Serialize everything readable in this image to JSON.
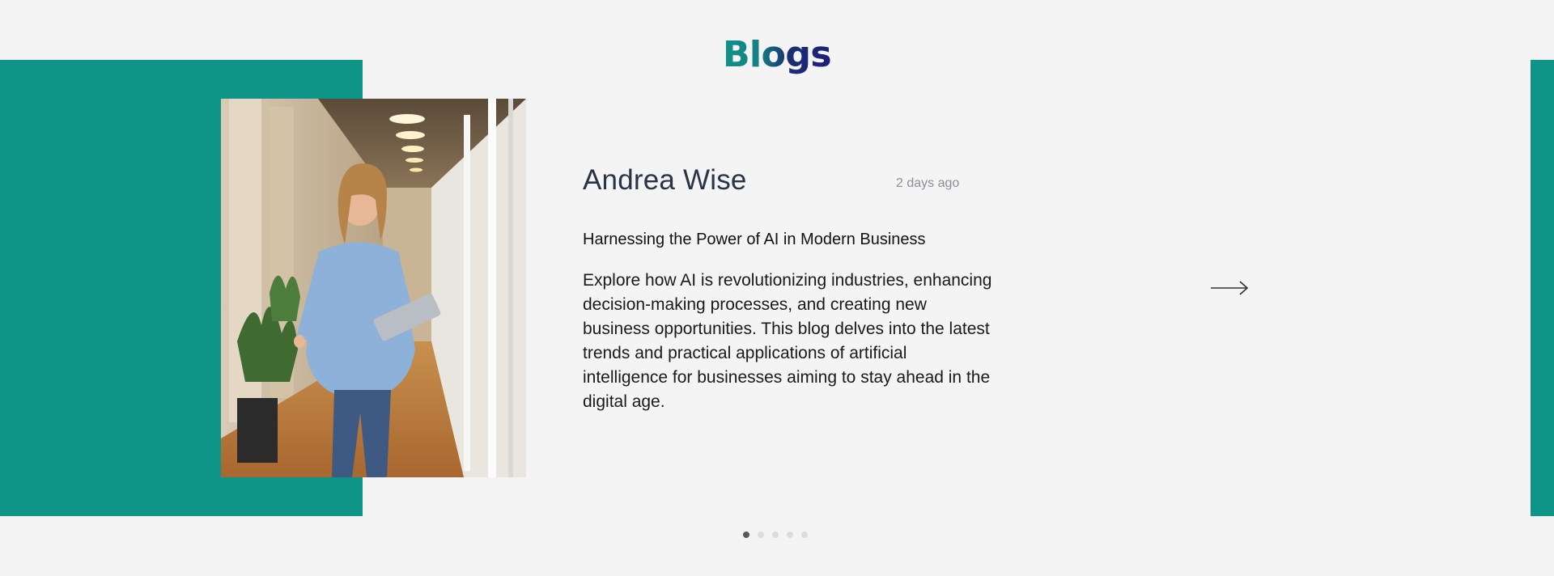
{
  "section": {
    "title": "Blogs"
  },
  "post": {
    "author": "Andrea Wise",
    "time_ago": "2 days ago",
    "title": "Harnessing the Power of AI in Modern Business",
    "excerpt": "Explore how AI is revolutionizing industries, enhancing decision-making processes, and creating new business opportunities. This blog delves into the latest trends and practical applications of artificial intelligence for businesses aiming to stay ahead in the digital age."
  },
  "navigation": {
    "next_icon": "arrow-right-icon",
    "active_slide": 1,
    "slides": [
      1,
      2,
      3,
      4,
      5
    ]
  },
  "colors": {
    "accent_teal": "#0f9488",
    "accent_navy": "#1d1f79",
    "background": "#f4f4f4"
  }
}
